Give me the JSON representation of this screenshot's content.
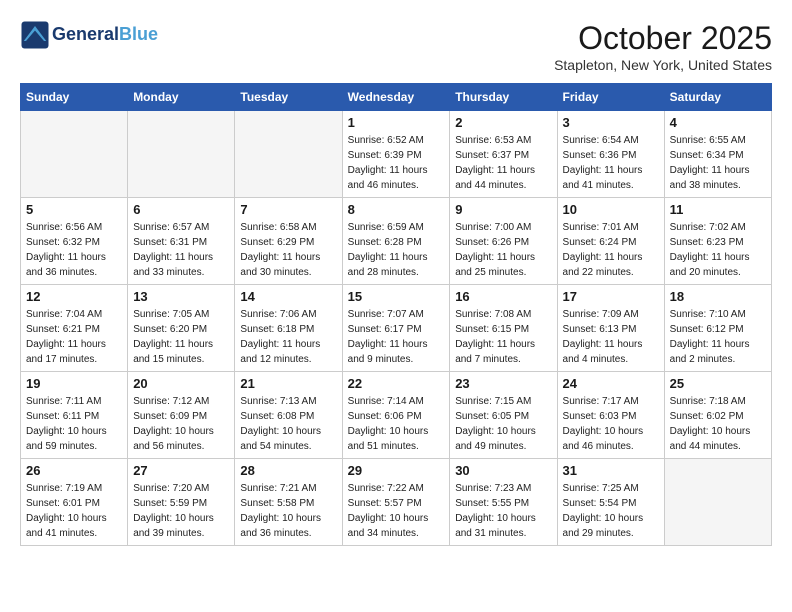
{
  "header": {
    "logo_line1": "General",
    "logo_line2": "Blue",
    "month": "October 2025",
    "location": "Stapleton, New York, United States"
  },
  "weekdays": [
    "Sunday",
    "Monday",
    "Tuesday",
    "Wednesday",
    "Thursday",
    "Friday",
    "Saturday"
  ],
  "weeks": [
    [
      {
        "day": "",
        "info": ""
      },
      {
        "day": "",
        "info": ""
      },
      {
        "day": "",
        "info": ""
      },
      {
        "day": "1",
        "info": "Sunrise: 6:52 AM\nSunset: 6:39 PM\nDaylight: 11 hours and 46 minutes."
      },
      {
        "day": "2",
        "info": "Sunrise: 6:53 AM\nSunset: 6:37 PM\nDaylight: 11 hours and 44 minutes."
      },
      {
        "day": "3",
        "info": "Sunrise: 6:54 AM\nSunset: 6:36 PM\nDaylight: 11 hours and 41 minutes."
      },
      {
        "day": "4",
        "info": "Sunrise: 6:55 AM\nSunset: 6:34 PM\nDaylight: 11 hours and 38 minutes."
      }
    ],
    [
      {
        "day": "5",
        "info": "Sunrise: 6:56 AM\nSunset: 6:32 PM\nDaylight: 11 hours and 36 minutes."
      },
      {
        "day": "6",
        "info": "Sunrise: 6:57 AM\nSunset: 6:31 PM\nDaylight: 11 hours and 33 minutes."
      },
      {
        "day": "7",
        "info": "Sunrise: 6:58 AM\nSunset: 6:29 PM\nDaylight: 11 hours and 30 minutes."
      },
      {
        "day": "8",
        "info": "Sunrise: 6:59 AM\nSunset: 6:28 PM\nDaylight: 11 hours and 28 minutes."
      },
      {
        "day": "9",
        "info": "Sunrise: 7:00 AM\nSunset: 6:26 PM\nDaylight: 11 hours and 25 minutes."
      },
      {
        "day": "10",
        "info": "Sunrise: 7:01 AM\nSunset: 6:24 PM\nDaylight: 11 hours and 22 minutes."
      },
      {
        "day": "11",
        "info": "Sunrise: 7:02 AM\nSunset: 6:23 PM\nDaylight: 11 hours and 20 minutes."
      }
    ],
    [
      {
        "day": "12",
        "info": "Sunrise: 7:04 AM\nSunset: 6:21 PM\nDaylight: 11 hours and 17 minutes."
      },
      {
        "day": "13",
        "info": "Sunrise: 7:05 AM\nSunset: 6:20 PM\nDaylight: 11 hours and 15 minutes."
      },
      {
        "day": "14",
        "info": "Sunrise: 7:06 AM\nSunset: 6:18 PM\nDaylight: 11 hours and 12 minutes."
      },
      {
        "day": "15",
        "info": "Sunrise: 7:07 AM\nSunset: 6:17 PM\nDaylight: 11 hours and 9 minutes."
      },
      {
        "day": "16",
        "info": "Sunrise: 7:08 AM\nSunset: 6:15 PM\nDaylight: 11 hours and 7 minutes."
      },
      {
        "day": "17",
        "info": "Sunrise: 7:09 AM\nSunset: 6:13 PM\nDaylight: 11 hours and 4 minutes."
      },
      {
        "day": "18",
        "info": "Sunrise: 7:10 AM\nSunset: 6:12 PM\nDaylight: 11 hours and 2 minutes."
      }
    ],
    [
      {
        "day": "19",
        "info": "Sunrise: 7:11 AM\nSunset: 6:11 PM\nDaylight: 10 hours and 59 minutes."
      },
      {
        "day": "20",
        "info": "Sunrise: 7:12 AM\nSunset: 6:09 PM\nDaylight: 10 hours and 56 minutes."
      },
      {
        "day": "21",
        "info": "Sunrise: 7:13 AM\nSunset: 6:08 PM\nDaylight: 10 hours and 54 minutes."
      },
      {
        "day": "22",
        "info": "Sunrise: 7:14 AM\nSunset: 6:06 PM\nDaylight: 10 hours and 51 minutes."
      },
      {
        "day": "23",
        "info": "Sunrise: 7:15 AM\nSunset: 6:05 PM\nDaylight: 10 hours and 49 minutes."
      },
      {
        "day": "24",
        "info": "Sunrise: 7:17 AM\nSunset: 6:03 PM\nDaylight: 10 hours and 46 minutes."
      },
      {
        "day": "25",
        "info": "Sunrise: 7:18 AM\nSunset: 6:02 PM\nDaylight: 10 hours and 44 minutes."
      }
    ],
    [
      {
        "day": "26",
        "info": "Sunrise: 7:19 AM\nSunset: 6:01 PM\nDaylight: 10 hours and 41 minutes."
      },
      {
        "day": "27",
        "info": "Sunrise: 7:20 AM\nSunset: 5:59 PM\nDaylight: 10 hours and 39 minutes."
      },
      {
        "day": "28",
        "info": "Sunrise: 7:21 AM\nSunset: 5:58 PM\nDaylight: 10 hours and 36 minutes."
      },
      {
        "day": "29",
        "info": "Sunrise: 7:22 AM\nSunset: 5:57 PM\nDaylight: 10 hours and 34 minutes."
      },
      {
        "day": "30",
        "info": "Sunrise: 7:23 AM\nSunset: 5:55 PM\nDaylight: 10 hours and 31 minutes."
      },
      {
        "day": "31",
        "info": "Sunrise: 7:25 AM\nSunset: 5:54 PM\nDaylight: 10 hours and 29 minutes."
      },
      {
        "day": "",
        "info": ""
      }
    ]
  ]
}
